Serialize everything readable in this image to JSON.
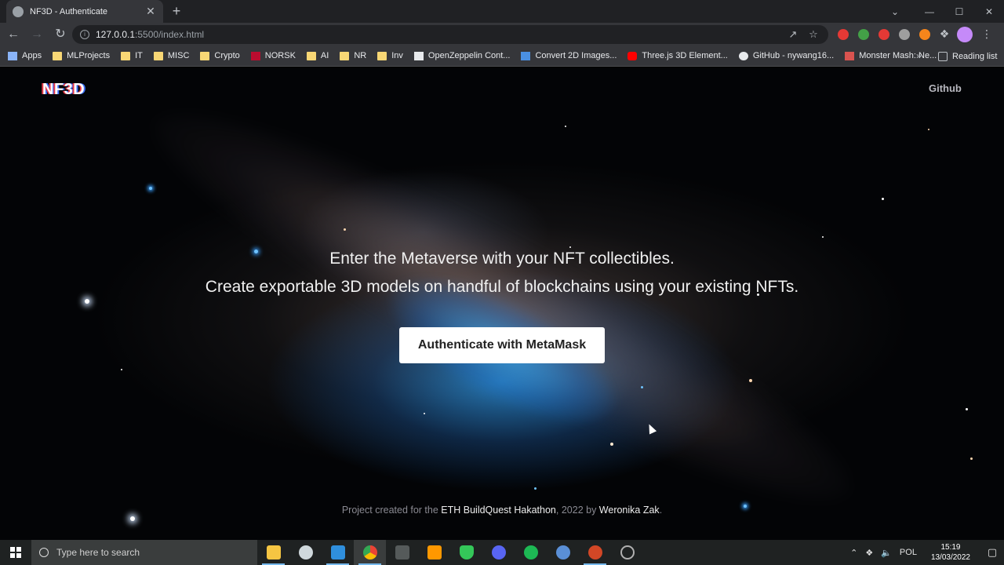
{
  "browser": {
    "tab_title": "NF3D - Authenticate",
    "tab_close": "✕",
    "new_tab": "+",
    "url_host": "127.0.0.1",
    "url_path": ":5500/index.html",
    "window_controls": {
      "tab_search": "⌄",
      "minimize": "—",
      "maximize": "☐",
      "close": "✕"
    }
  },
  "bookmarks": [
    {
      "label": "Apps",
      "icon": "apps-icon",
      "color": "#8ab4f8"
    },
    {
      "label": "MLProjects",
      "icon": "folder-icon",
      "color": "#f8d775"
    },
    {
      "label": "IT",
      "icon": "folder-icon",
      "color": "#f8d775"
    },
    {
      "label": "MISC",
      "icon": "folder-icon",
      "color": "#f8d775"
    },
    {
      "label": "Crypto",
      "icon": "folder-icon",
      "color": "#f8d775"
    },
    {
      "label": "NORSK",
      "icon": "flag-icon",
      "color": "#ba0c2f"
    },
    {
      "label": "AI",
      "icon": "folder-icon",
      "color": "#f8d775"
    },
    {
      "label": "NR",
      "icon": "folder-icon",
      "color": "#f8d775"
    },
    {
      "label": "Inv",
      "icon": "folder-icon",
      "color": "#f8d775"
    },
    {
      "label": "OpenZeppelin Cont...",
      "icon": "openzeppelin-icon",
      "color": "#e8eaed"
    },
    {
      "label": "Convert 2D Images...",
      "icon": "layers-icon",
      "color": "#4a90e2"
    },
    {
      "label": "Three.js 3D Element...",
      "icon": "youtube-icon",
      "color": "#ff0000"
    },
    {
      "label": "GitHub - nywang16...",
      "icon": "github-icon",
      "color": "#e8eaed"
    },
    {
      "label": "Monster Mash: Ne...",
      "icon": "monster-icon",
      "color": "#d9534f"
    }
  ],
  "bookmarks_overflow": "»",
  "reading_list": "Reading list",
  "page": {
    "logo": "NF3D",
    "github_link": "Github",
    "hero_line_1": "Enter the Metaverse with your NFT collectibles.",
    "hero_line_2": "Create exportable 3D models on handful of blockchains using your existing NFTs.",
    "auth_button": "Authenticate with MetaMask",
    "footer": {
      "prefix": "Project created for the ",
      "event": "ETH BuildQuest Hakathon",
      "middle": ", 2022 by ",
      "author": "Weronika Zak",
      "suffix": "."
    }
  },
  "taskbar": {
    "search_placeholder": "Type here to search",
    "apps": [
      {
        "name": "file-explorer-icon",
        "color": "#f5c542"
      },
      {
        "name": "app-icon",
        "color": "#cfd8dc"
      },
      {
        "name": "vscode-icon",
        "color": "#2f8fdd"
      },
      {
        "name": "chrome-icon",
        "color": "#fbbc04"
      },
      {
        "name": "terminal-icon",
        "color": "#555a5a"
      },
      {
        "name": "sublime-icon",
        "color": "#ff9800"
      },
      {
        "name": "shield-app-icon",
        "color": "#34c759"
      },
      {
        "name": "discord-icon",
        "color": "#5865f2"
      },
      {
        "name": "spotify-icon",
        "color": "#1db954"
      },
      {
        "name": "globe-app-icon",
        "color": "#5a8fd6"
      },
      {
        "name": "powerpoint-icon",
        "color": "#d24726"
      },
      {
        "name": "obs-icon",
        "color": "#b0b0b0"
      }
    ],
    "tray_language": "POL",
    "time": "15:19",
    "date": "13/03/2022"
  }
}
